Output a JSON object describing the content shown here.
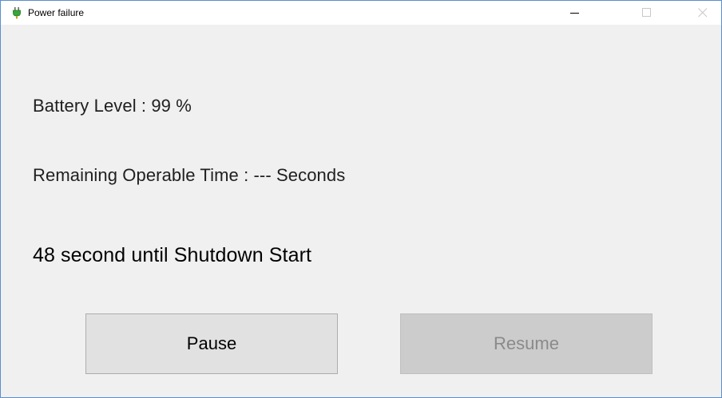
{
  "window": {
    "title": "Power failure",
    "icon": "power-plug-icon"
  },
  "titlebar_controls": {
    "minimize_icon": "minimize-icon",
    "maximize_icon": "maximize-icon",
    "close_icon": "close-icon"
  },
  "status": {
    "battery_level": "Battery Level : 99 %",
    "remaining_time": "Remaining Operable Time : --- Seconds",
    "shutdown_countdown": "48 second until Shutdown Start"
  },
  "buttons": {
    "pause_label": "Pause",
    "resume_label": "Resume",
    "resume_enabled": false
  },
  "colors": {
    "window_border": "#5a8fd0",
    "window_bg": "#f0f0f0",
    "button_bg": "#e1e1e1",
    "disabled_button_bg": "#cccccc",
    "disabled_text": "#8a8a8a"
  }
}
